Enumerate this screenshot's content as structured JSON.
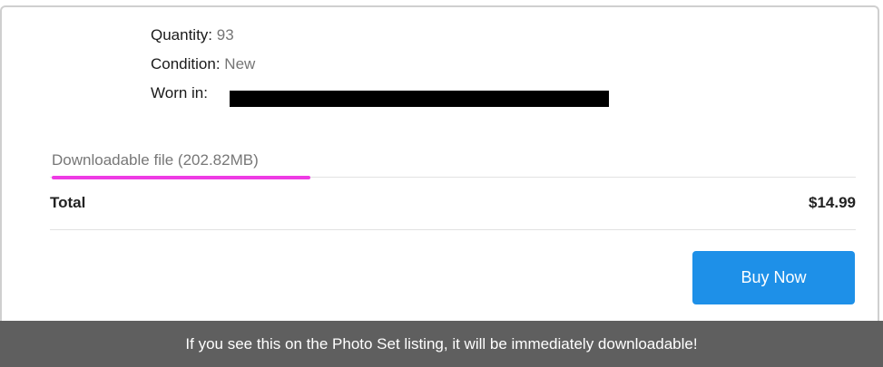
{
  "details": {
    "quantity_label": "Quantity:",
    "quantity_value": "93",
    "condition_label": "Condition:",
    "condition_value": "New",
    "worn_label": "Worn in:"
  },
  "download": {
    "label": "Downloadable file (202.82MB)"
  },
  "total": {
    "label": "Total",
    "value": "$14.99"
  },
  "actions": {
    "buy_label": "Buy Now"
  },
  "banner": {
    "text": "If you see this on the Photo Set listing, it will be immediately downloadable!"
  },
  "colors": {
    "accent": "#1e90e8",
    "highlight_underline": "#ee3be4",
    "banner_bg": "#5f5f5f"
  }
}
